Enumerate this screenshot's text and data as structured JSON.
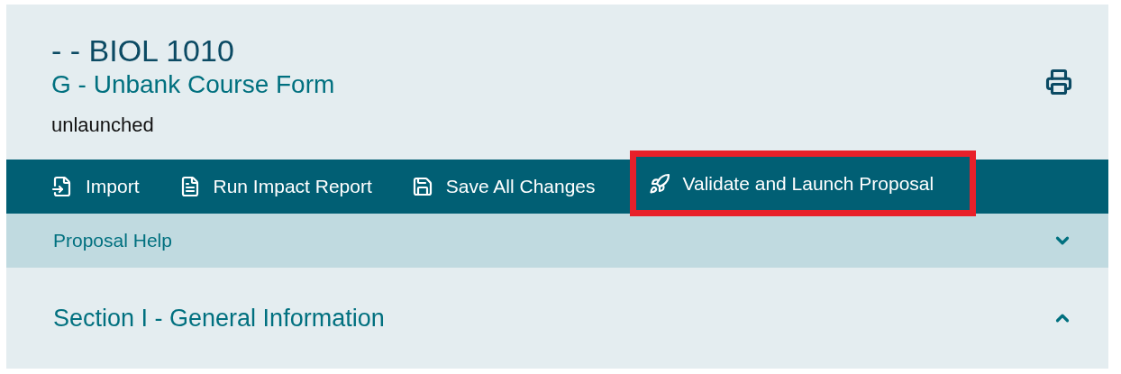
{
  "header": {
    "title": "- - BIOL 1010",
    "subtitle": "G - Unbank Course Form",
    "status": "unlaunched"
  },
  "toolbar": [
    {
      "kind": "import",
      "label": "Import",
      "highlighted": false
    },
    {
      "kind": "report",
      "label": "Run Impact Report",
      "highlighted": false
    },
    {
      "kind": "save",
      "label": "Save All Changes",
      "highlighted": false
    },
    {
      "kind": "launch",
      "label": "Validate and Launch Proposal",
      "highlighted": true
    }
  ],
  "sections": [
    {
      "kind": "help",
      "title": "Proposal Help",
      "expanded": false
    },
    {
      "kind": "section",
      "title": "Section I - General Information",
      "expanded": true
    }
  ]
}
